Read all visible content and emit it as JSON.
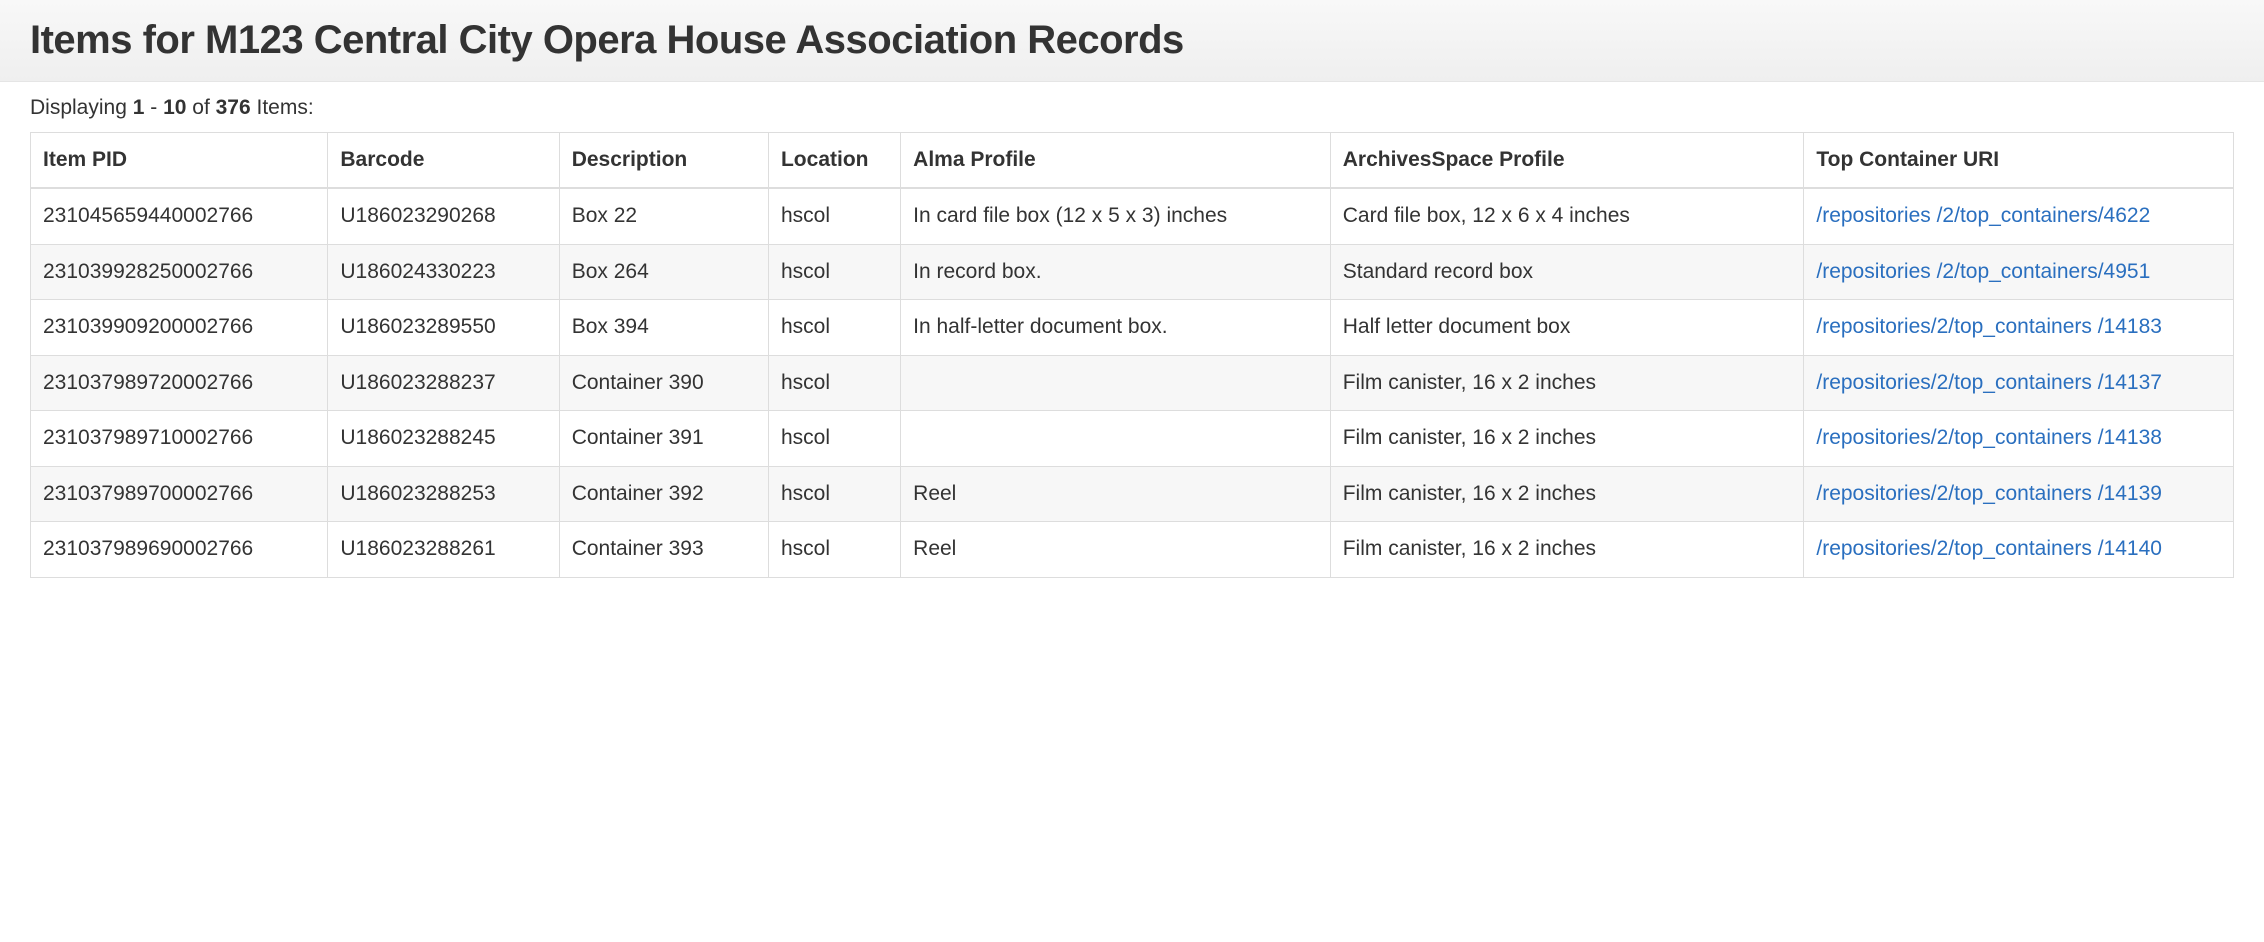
{
  "header": {
    "title": "Items for M123 Central City Opera House Association Records"
  },
  "summary": {
    "prefix": "Displaying ",
    "from": "1",
    "dash": " - ",
    "to": "10",
    "of_word": " of ",
    "total": "376",
    "suffix": " Items:"
  },
  "table": {
    "columns": [
      "Item PID",
      "Barcode",
      "Description",
      "Location",
      "Alma Profile",
      "ArchivesSpace Profile",
      "Top Container URI"
    ],
    "rows": [
      {
        "pid": "231045659440002766",
        "barcode": "U186023290268",
        "description": "Box 22",
        "location": "hscol",
        "alma": "In card file box (12 x 5 x 3) inches",
        "aspace": "Card file box, 12 x 6 x 4 inches",
        "uri": "/repositories/2/top_containers/4622",
        "uri_display": "/repositories /2/top_containers/4622"
      },
      {
        "pid": "231039928250002766",
        "barcode": "U186024330223",
        "description": "Box 264",
        "location": "hscol",
        "alma": "In record box.",
        "aspace": "Standard record box",
        "uri": "/repositories/2/top_containers/4951",
        "uri_display": "/repositories /2/top_containers/4951"
      },
      {
        "pid": "231039909200002766",
        "barcode": "U186023289550",
        "description": "Box 394",
        "location": "hscol",
        "alma": "In half-letter document box.",
        "aspace": "Half letter document box",
        "uri": "/repositories/2/top_containers/14183",
        "uri_display": "/repositories/2/top_containers /14183"
      },
      {
        "pid": "231037989720002766",
        "barcode": "U186023288237",
        "description": "Container 390",
        "location": "hscol",
        "alma": "",
        "aspace": "Film canister, 16 x 2 inches",
        "uri": "/repositories/2/top_containers/14137",
        "uri_display": "/repositories/2/top_containers /14137"
      },
      {
        "pid": "231037989710002766",
        "barcode": "U186023288245",
        "description": "Container 391",
        "location": "hscol",
        "alma": "",
        "aspace": "Film canister, 16 x 2 inches",
        "uri": "/repositories/2/top_containers/14138",
        "uri_display": "/repositories/2/top_containers /14138"
      },
      {
        "pid": "231037989700002766",
        "barcode": "U186023288253",
        "description": "Container 392",
        "location": "hscol",
        "alma": "Reel",
        "aspace": "Film canister, 16 x 2 inches",
        "uri": "/repositories/2/top_containers/14139",
        "uri_display": "/repositories/2/top_containers /14139"
      },
      {
        "pid": "231037989690002766",
        "barcode": "U186023288261",
        "description": "Container 393",
        "location": "hscol",
        "alma": "Reel",
        "aspace": "Film canister, 16 x 2 inches",
        "uri": "/repositories/2/top_containers/14140",
        "uri_display": "/repositories/2/top_containers /14140"
      }
    ]
  }
}
